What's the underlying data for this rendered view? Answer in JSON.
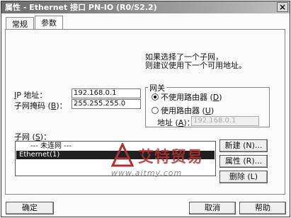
{
  "window": {
    "title": "属性 - Ethernet 接口 PN-IO (R0/S2.2)",
    "close_glyph": "×"
  },
  "tabs": [
    {
      "label": "常规"
    },
    {
      "label": "参数"
    }
  ],
  "hint": {
    "line1": "如果选择了一个子网，",
    "line2": "则建议使用下一个可用地址。"
  },
  "ip": {
    "label_key": "I",
    "label_rest": "P 地址：",
    "value": "192.168.0.1"
  },
  "mask": {
    "label_pre": "子网掩码 (",
    "label_key": "B",
    "label_post": ")：",
    "value": "255.255.255.0"
  },
  "gateway": {
    "title": "网关",
    "opt_no_router": {
      "pre": "不使用路由器 (",
      "key": "D",
      "post": ")",
      "selected": true
    },
    "opt_router": {
      "pre": "使用路由器 (",
      "key": "U",
      "post": ")",
      "selected": false
    },
    "address_label_pre": "地址 (",
    "address_key": "A",
    "address_label_post": ")：",
    "address_value": "192.168.0.1"
  },
  "subnet": {
    "label_pre": "子网 (",
    "label_key": "S",
    "label_post": ")：",
    "items": [
      {
        "text": "--- 未连网 ---",
        "selected": false
      },
      {
        "text": "Ethernet(1)",
        "selected": true
      }
    ]
  },
  "side_buttons": {
    "new": "新建 (N)...",
    "props": "属性 (R)...",
    "delete": "删除 (L)"
  },
  "footer": {
    "ok": "确定",
    "cancel": "取消",
    "help": "帮助"
  },
  "watermark": {
    "text": "艾特贸易",
    "url": "www.aitmy.com"
  }
}
